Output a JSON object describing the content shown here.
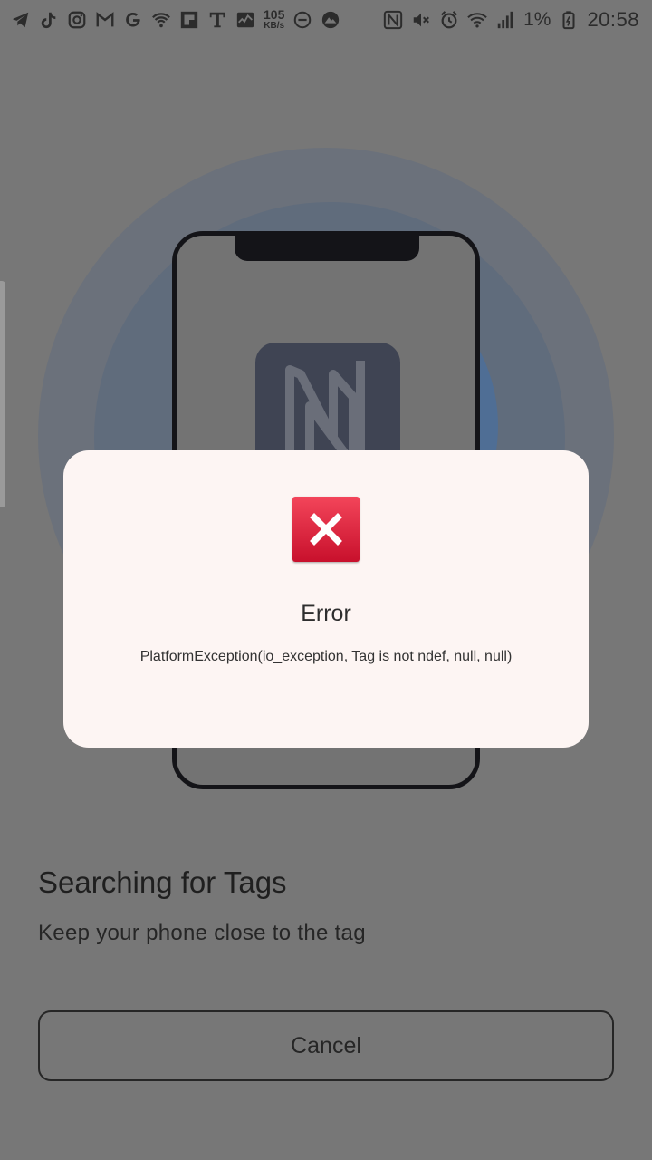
{
  "status_bar": {
    "left_icons": [
      "telegram-icon",
      "tiktok-icon",
      "instagram-icon",
      "gmail-icon",
      "google-icon",
      "vpn-shield-icon",
      "flipboard-icon",
      "t-mobile-icon",
      "activity-icon"
    ],
    "net_speed_value": "105",
    "net_speed_unit": "KB/s",
    "extra_icons": [
      "do-not-disturb-icon",
      "mountain-icon"
    ],
    "right_icons": [
      "nfc-icon",
      "mute-icon",
      "alarm-icon",
      "wifi-icon",
      "cell-signal-icon"
    ],
    "battery_percent": "1%",
    "battery_icon": "battery-low-icon",
    "time": "20:58"
  },
  "illustration": {
    "icon": "nfc-logo-icon",
    "device": "phone-outline"
  },
  "dialog": {
    "icon": "error-x-icon",
    "icon_color": "#e11f3a",
    "title": "Error",
    "message": "PlatformException(io_exception, Tag is not ndef, null, null)"
  },
  "scan": {
    "title": "Searching for Tags",
    "subtitle": "Keep your phone close to the tag",
    "cancel_label": "Cancel"
  },
  "colors": {
    "scrim": "#777777",
    "dialog_bg": "#fdf5f3",
    "error_red": "#e11f3a"
  }
}
